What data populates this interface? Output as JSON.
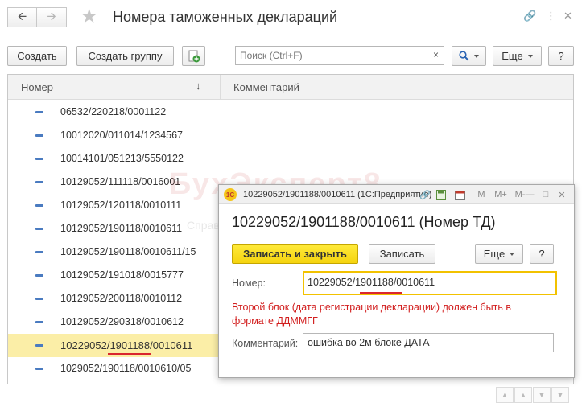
{
  "header": {
    "title": "Номера таможенных деклараций",
    "icons": [
      "link-icon",
      "more-vert-icon",
      "close-icon"
    ]
  },
  "toolbar": {
    "create_label": "Создать",
    "create_group_label": "Создать группу",
    "more_label": "Еще",
    "help_label": "?"
  },
  "search": {
    "placeholder": "Поиск (Ctrl+F)",
    "clear_label": "×"
  },
  "list": {
    "columns": {
      "number": "Номер",
      "comment": "Комментарий",
      "sort_indicator": "↓"
    },
    "rows": [
      "06532/220218/0001122",
      "10012020/011014/1234567",
      "10014101/051213/5550122",
      "10129052/111118/0016001",
      "10129052/120118/0010111",
      "10129052/190118/0010611",
      "10129052/190118/0010611/15",
      "10129052/191018/0015777",
      "10129052/200118/0010112",
      "10129052/290318/0010612",
      "10229052/1901188/0010611",
      "1029052/190118/0010610/05"
    ],
    "selected_row": "10229052/1901188/0010611"
  },
  "watermark": {
    "text": "БухЭксперт8",
    "subtext": "Справочник"
  },
  "dialog": {
    "window_title": "10229052/1901188/0010611  (1С:Предприятие)",
    "logo_text": "1С",
    "title_icons": [
      "link-icon",
      "calculator-icon",
      "calendar-icon",
      "memory-m-icon",
      "memory-mplus-icon",
      "memory-mminus-icon",
      "minimize-icon",
      "maximize-icon",
      "close-icon"
    ],
    "memory_labels": [
      "M",
      "M+",
      "M-"
    ],
    "heading": "10229052/1901188/0010611 (Номер ТД)",
    "save_close_label": "Записать и закрыть",
    "save_label": "Записать",
    "more_label": "Еще",
    "help_label": "?",
    "number_label": "Номер:",
    "number_value": "10229052/1901188/0010611",
    "error_text": "Второй блок (дата регистрации декларации) должен быть в формате ДДММГГ",
    "comment_label": "Комментарий:",
    "comment_value": "ошибка во 2м блоке ДАТА"
  },
  "colors": {
    "selected_row": "#fbeea7",
    "error": "#d21f1f",
    "primary_button": "#f5d40f",
    "row_marker": "#4a7bc0"
  }
}
